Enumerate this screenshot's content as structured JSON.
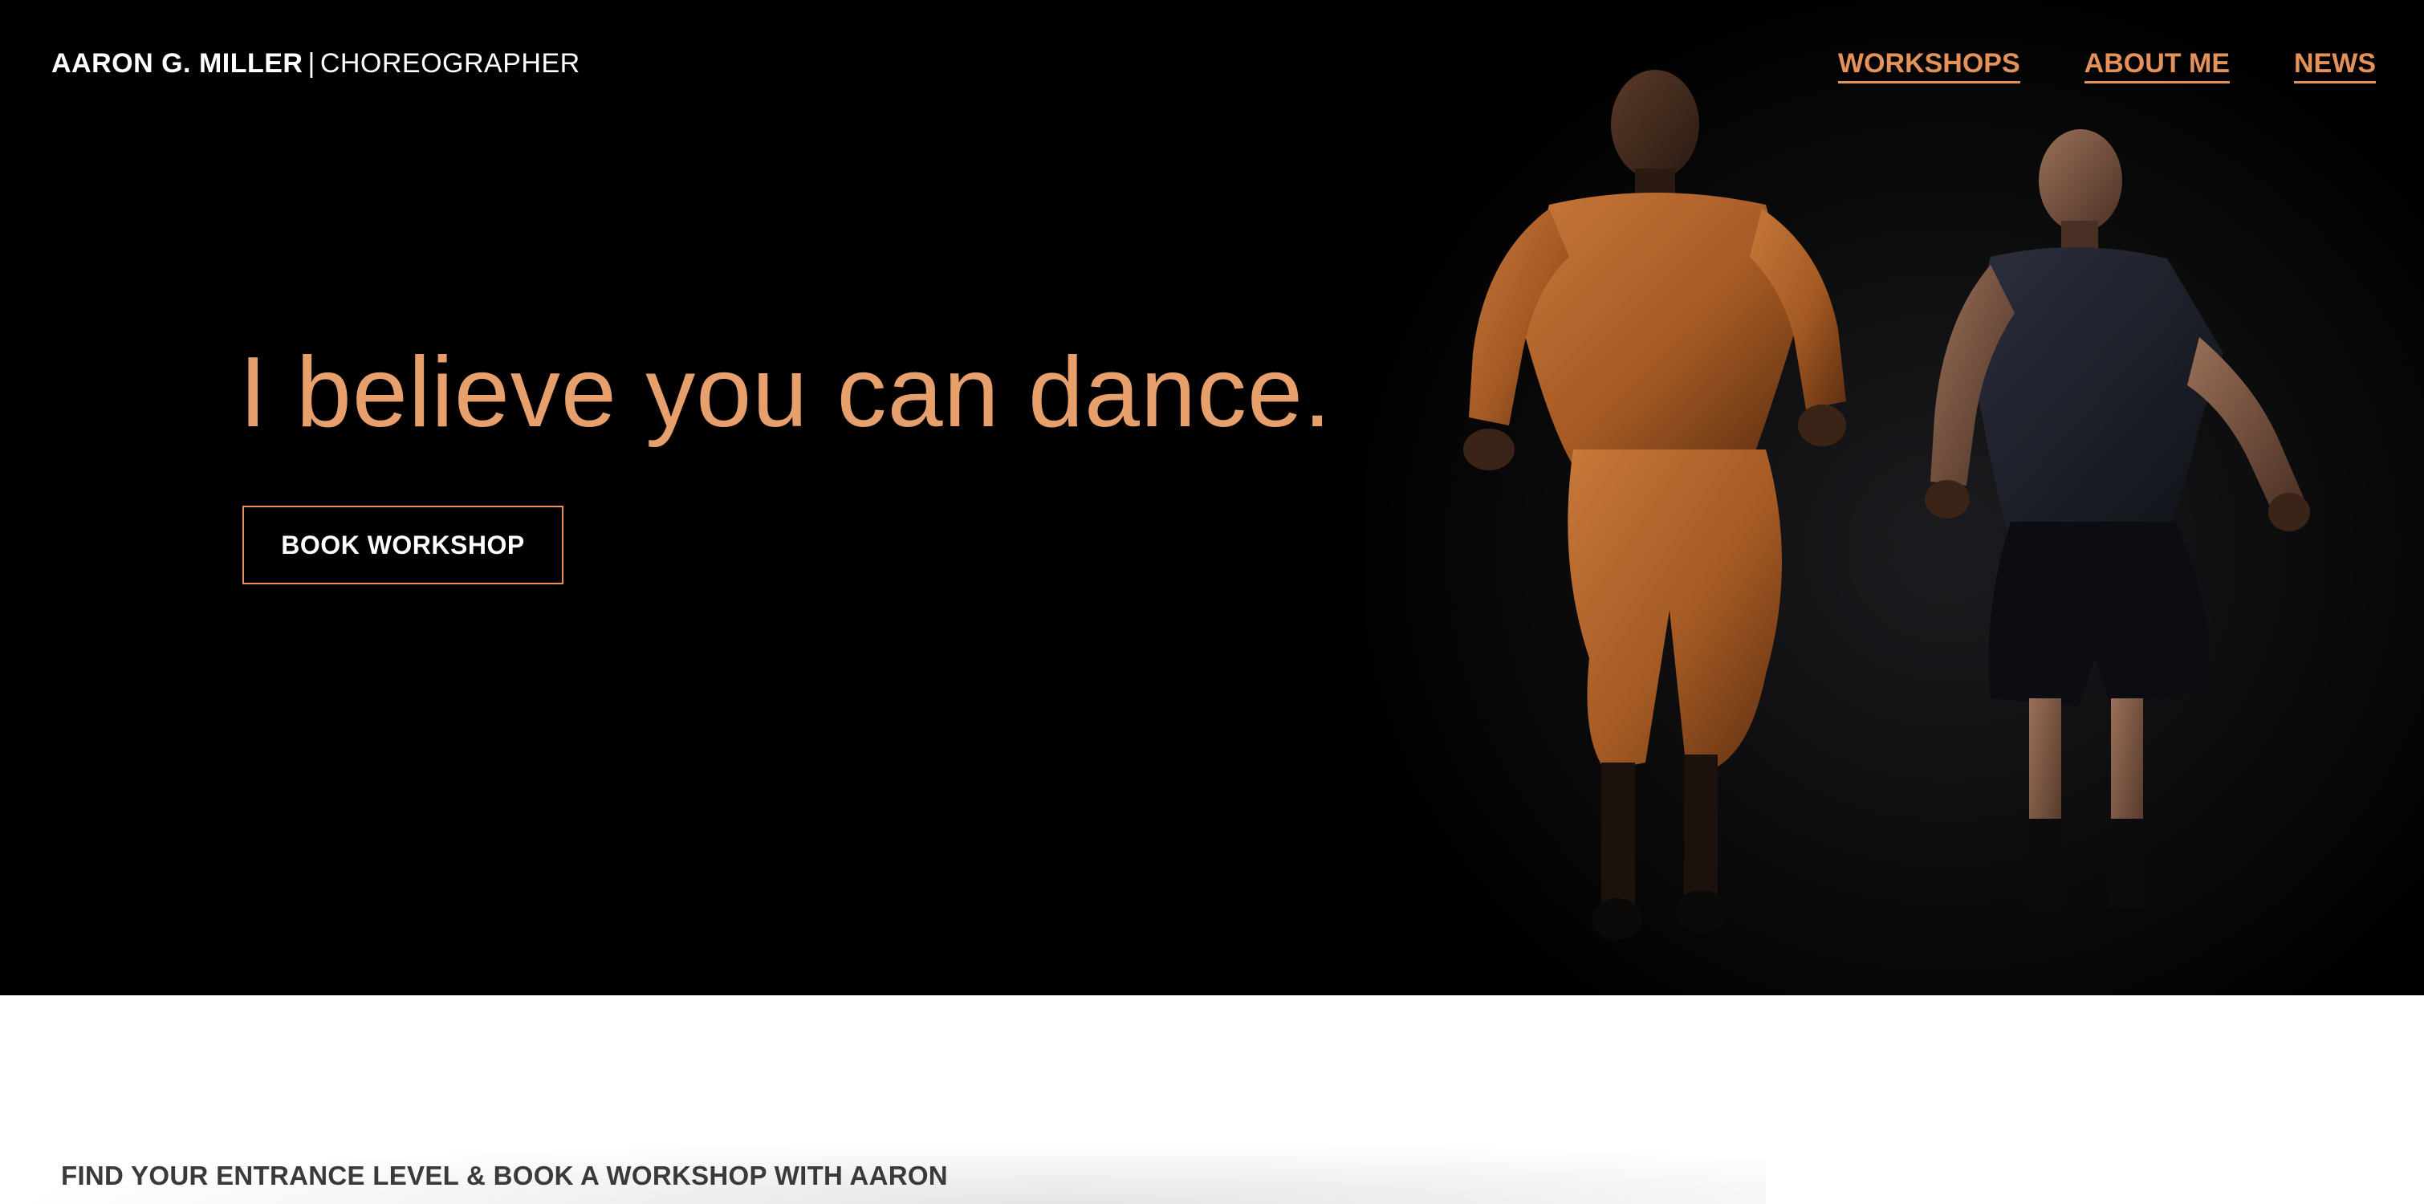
{
  "header": {
    "brand_name": "AARON G. MILLER",
    "brand_separator": "|",
    "brand_role": "CHOREOGRAPHER"
  },
  "nav": {
    "items": [
      {
        "label": "WORKSHOPS"
      },
      {
        "label": "ABOUT ME"
      },
      {
        "label": "NEWS"
      }
    ]
  },
  "hero": {
    "headline": "I believe you can dance.",
    "cta_label": "BOOK WORKSHOP"
  },
  "section": {
    "title": "FIND YOUR ENTRANCE LEVEL & BOOK A WORKSHOP WITH AARON"
  },
  "colors": {
    "accent": "#e4915a",
    "headline": "#e7a06c",
    "hero_background": "#000000",
    "page_background": "#ffffff"
  }
}
